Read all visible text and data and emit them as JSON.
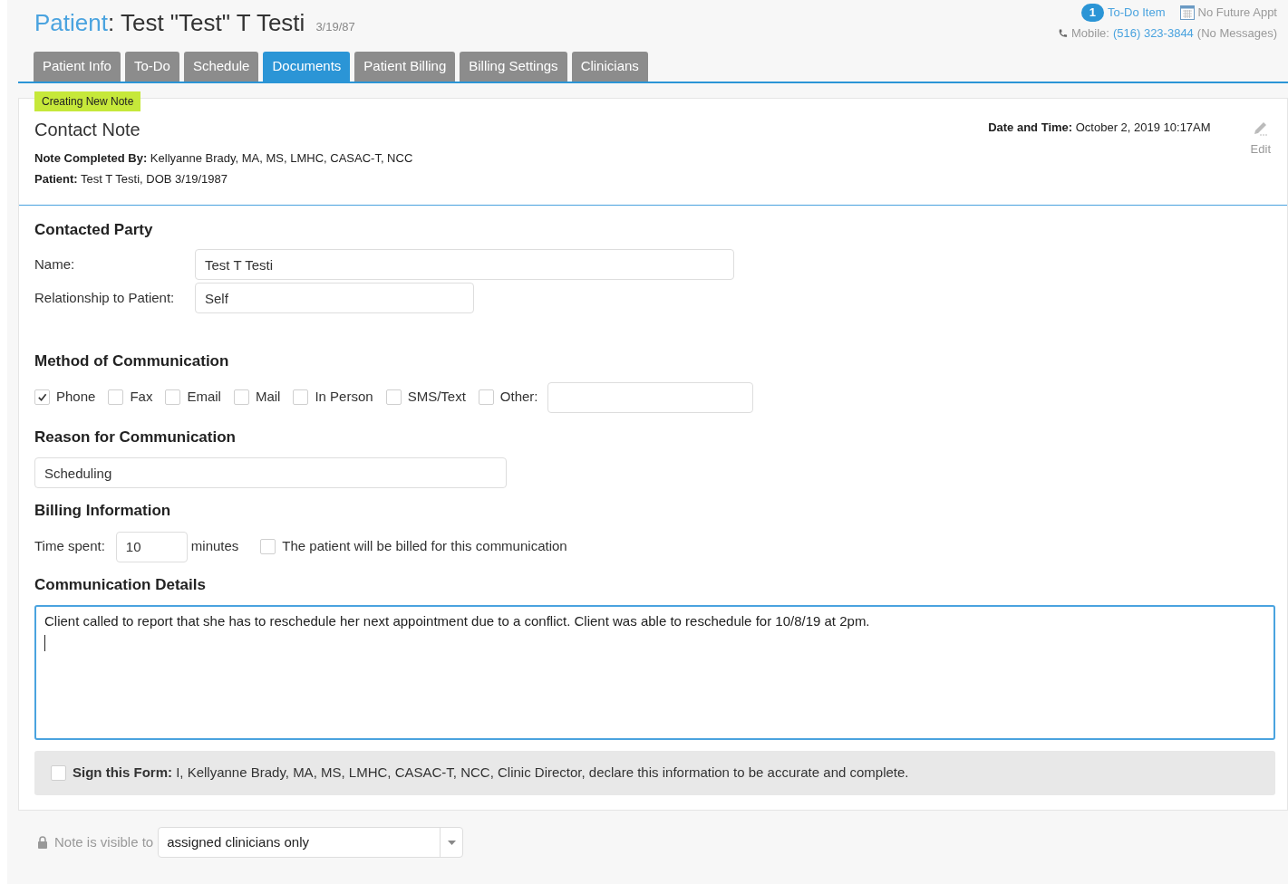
{
  "header": {
    "title_prefix": "Patient",
    "title_name": ": Test \"Test\" T Testi",
    "dob_short": "3/19/87",
    "todo_count": "1",
    "todo_label": "To-Do Item",
    "appt_label": "No Future Appt",
    "mobile_label": "Mobile:",
    "mobile_number": "(516) 323-3844",
    "messages": "(No Messages)"
  },
  "tabs": [
    {
      "label": "Patient Info",
      "selected": false
    },
    {
      "label": "To-Do",
      "selected": false
    },
    {
      "label": "Schedule",
      "selected": false
    },
    {
      "label": "Documents",
      "selected": true
    },
    {
      "label": "Patient Billing",
      "selected": false
    },
    {
      "label": "Billing Settings",
      "selected": false
    },
    {
      "label": "Clinicians",
      "selected": false
    }
  ],
  "note": {
    "badge": "Creating New Note",
    "title": "Contact Note",
    "completed_by": "**Note Completed By:** Kellyanne Brady, MA, MS, LMHC, CASAC-T, NCC",
    "patient": "**Patient:** Test T Testi, DOB 3/19/1987",
    "date_time": "**Date and Time:** October 2, 2019 10:17AM",
    "edit_label": "Edit"
  },
  "contacted_party": {
    "heading": "Contacted Party",
    "name_label": "Name:",
    "name_value": "Test T Testi",
    "relationship_label": "Relationship to Patient:",
    "relationship_value": "Self"
  },
  "method": {
    "heading": "Method of Communication",
    "options": [
      {
        "label": "Phone",
        "checked": true
      },
      {
        "label": "Fax",
        "checked": false
      },
      {
        "label": "Email",
        "checked": false
      },
      {
        "label": "Mail",
        "checked": false
      },
      {
        "label": "In Person",
        "checked": false
      },
      {
        "label": "SMS/Text",
        "checked": false
      },
      {
        "label": "Other:",
        "checked": false
      }
    ]
  },
  "reason": {
    "heading": "Reason for Communication",
    "value": "Scheduling"
  },
  "billing": {
    "heading": "Billing Information",
    "time_label": "Time spent:",
    "time_value": "10",
    "unit": "minutes",
    "billed_label": "The patient will be billed for this communication",
    "billed": false
  },
  "details": {
    "heading": "Communication Details",
    "value": "Client called to report that she has to reschedule her next appointment due to a conflict. Client was able to reschedule for 10/8/19 at 2pm."
  },
  "sign": {
    "checked": false,
    "text": "**Sign this Form:** I, Kellyanne Brady, MA, MS, LMHC, CASAC-T, NCC, Clinic Director, declare this information to be accurate and complete."
  },
  "visibility": {
    "label": "Note is visible to",
    "value": "assigned clinicians only"
  }
}
